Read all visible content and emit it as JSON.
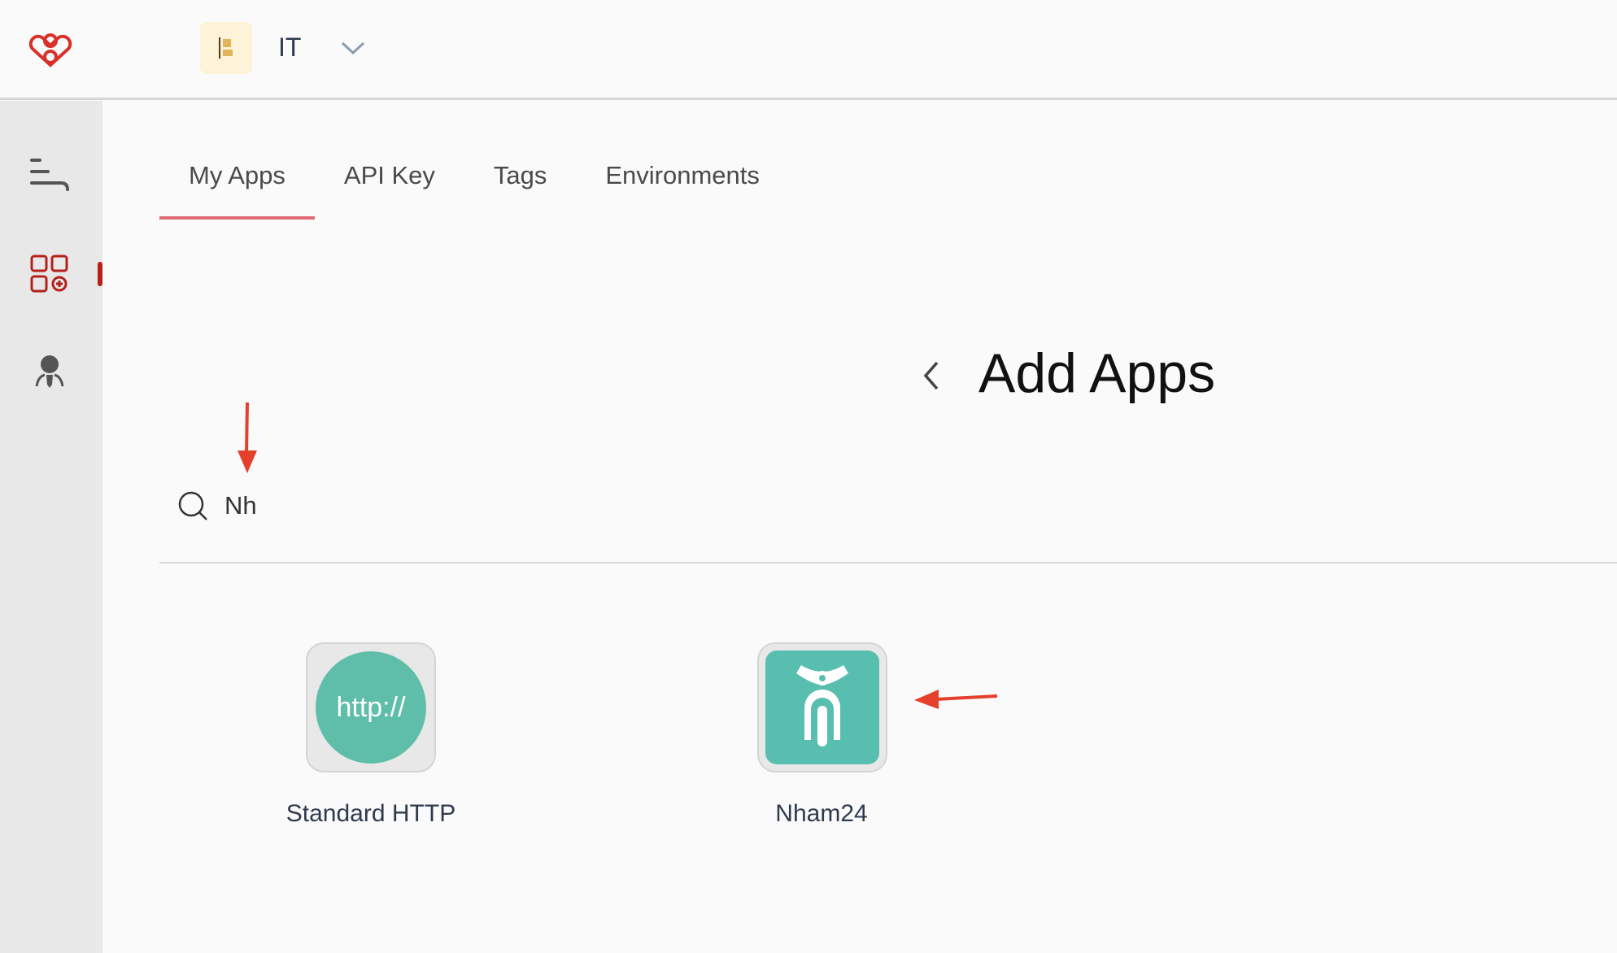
{
  "header": {
    "org_name": "IT",
    "logo": "heart-knot-logo",
    "org_icon": "org-icon"
  },
  "sidebar": {
    "items": [
      {
        "icon": "collapse-menu-icon"
      },
      {
        "icon": "apps-add-icon",
        "active": true
      },
      {
        "icon": "user-icon"
      }
    ]
  },
  "tabs": [
    {
      "label": "My Apps",
      "active": true
    },
    {
      "label": "API Key"
    },
    {
      "label": "Tags"
    },
    {
      "label": "Environments"
    }
  ],
  "page": {
    "title": "Add Apps"
  },
  "search": {
    "value": "Nh",
    "placeholder": ""
  },
  "apps": [
    {
      "label": "Standard HTTP",
      "icon_text": "http://"
    },
    {
      "label": "Nham24"
    }
  ],
  "colors": {
    "accent": "#b5211a",
    "tab_underline": "#e06a74",
    "app_teal": "#58bfb0",
    "annotation": "#e5402c"
  }
}
